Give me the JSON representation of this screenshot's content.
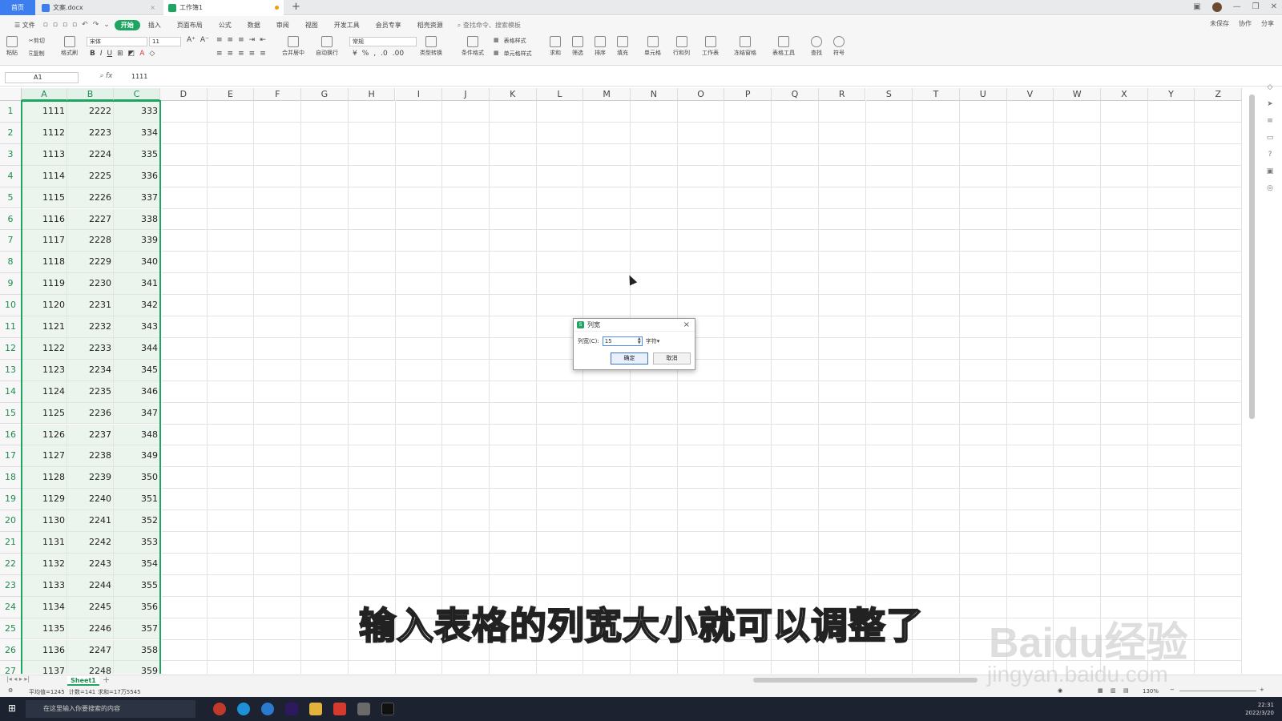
{
  "tabs": {
    "home": "首页",
    "doc": "文案.docx",
    "sheet": "工作簿1"
  },
  "menu": {
    "items": [
      "文件",
      "开始",
      "插入",
      "页面布局",
      "公式",
      "数据",
      "审阅",
      "视图",
      "开发工具",
      "会员专享",
      "稻壳资源"
    ],
    "active_index": 1,
    "search": "查找命令、搜索模板",
    "right": [
      "未保存",
      "协作",
      "分享"
    ]
  },
  "ribbon": {
    "paste": "粘贴",
    "cut": "剪切",
    "copy": "复制",
    "format_painter": "格式刷",
    "font": "宋体",
    "size": "11",
    "merge": "合并居中",
    "wrap": "自动换行",
    "number_format": "常规",
    "type_convert": "类型转换",
    "cond_format": "条件格式",
    "table_style": "表格样式",
    "cell_style": "单元格样式",
    "sum": "求和",
    "filter": "筛选",
    "sort": "排序",
    "fill": "填充",
    "cell": "单元格",
    "rowcol": "行和列",
    "worksheet": "工作表",
    "freeze": "冻结窗格",
    "table_tools": "表格工具",
    "find": "查找",
    "symbol": "符号"
  },
  "formula": {
    "cell_ref": "A1",
    "value": "1111"
  },
  "columns": [
    "A",
    "B",
    "C",
    "D",
    "E",
    "F",
    "G",
    "H",
    "I",
    "J",
    "K",
    "L",
    "M",
    "N",
    "O",
    "P",
    "Q",
    "R",
    "S",
    "T",
    "U",
    "V",
    "W",
    "X",
    "Y",
    "Z"
  ],
  "rows": [
    [
      "1",
      "1111",
      "2222",
      "333"
    ],
    [
      "2",
      "1112",
      "2223",
      "334"
    ],
    [
      "3",
      "1113",
      "2224",
      "335"
    ],
    [
      "4",
      "1114",
      "2225",
      "336"
    ],
    [
      "5",
      "1115",
      "2226",
      "337"
    ],
    [
      "6",
      "1116",
      "2227",
      "338"
    ],
    [
      "7",
      "1117",
      "2228",
      "339"
    ],
    [
      "8",
      "1118",
      "2229",
      "340"
    ],
    [
      "9",
      "1119",
      "2230",
      "341"
    ],
    [
      "10",
      "1120",
      "2231",
      "342"
    ],
    [
      "11",
      "1121",
      "2232",
      "343"
    ],
    [
      "12",
      "1122",
      "2233",
      "344"
    ],
    [
      "13",
      "1123",
      "2234",
      "345"
    ],
    [
      "14",
      "1124",
      "2235",
      "346"
    ],
    [
      "15",
      "1125",
      "2236",
      "347"
    ],
    [
      "16",
      "1126",
      "2237",
      "348"
    ],
    [
      "17",
      "1127",
      "2238",
      "349"
    ],
    [
      "18",
      "1128",
      "2239",
      "350"
    ],
    [
      "19",
      "1129",
      "2240",
      "351"
    ],
    [
      "20",
      "1130",
      "2241",
      "352"
    ],
    [
      "21",
      "1131",
      "2242",
      "353"
    ],
    [
      "22",
      "1132",
      "2243",
      "354"
    ],
    [
      "23",
      "1133",
      "2244",
      "355"
    ],
    [
      "24",
      "1134",
      "2245",
      "356"
    ],
    [
      "25",
      "1135",
      "2246",
      "357"
    ],
    [
      "26",
      "1136",
      "2247",
      "358"
    ],
    [
      "27",
      "1137",
      "2248",
      "359"
    ]
  ],
  "sheet": {
    "name": "Sheet1"
  },
  "status": {
    "avg": "平均值=1245",
    "count": "计数=141",
    "sum": "求和=17万5545",
    "zoom": "130%"
  },
  "dialog": {
    "title": "列宽",
    "label": "列宽(C):",
    "value": "15",
    "unit": "字符",
    "ok": "确定",
    "cancel": "取消"
  },
  "taskbar": {
    "search": "在这里输入你要搜索的内容",
    "time": "22:31",
    "date": "2022/3/20"
  },
  "subtitle": "输入表格的列宽大小就可以调整了",
  "watermark": {
    "line1": "Baidu经验",
    "line2": "jingyan.baidu.com"
  },
  "colors": {
    "accent": "#1fa562",
    "home_tab": "#3c7ef0"
  }
}
